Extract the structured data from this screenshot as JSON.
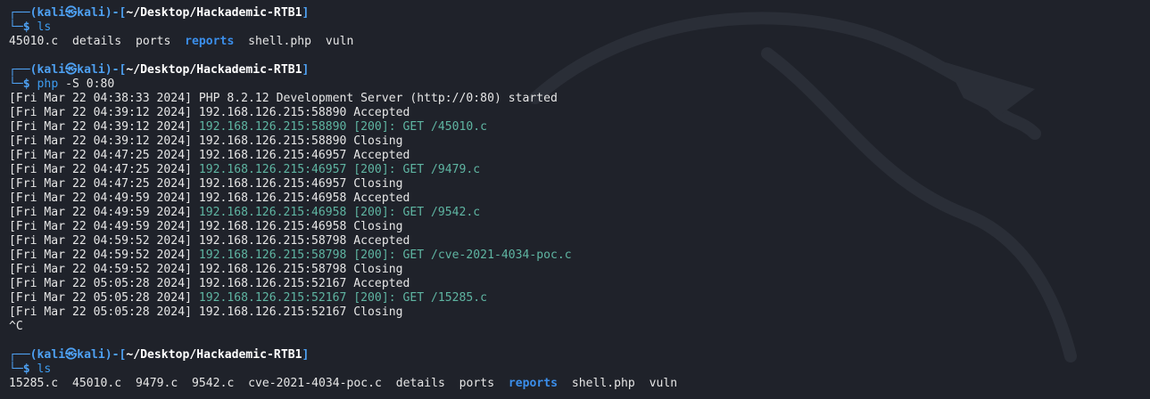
{
  "terminal": {
    "user": "kali",
    "host": "kali",
    "at_symbol": "㉿",
    "path": "~/Desktop/Hackademic-RTB1",
    "prompt_top_left": "┌──(",
    "prompt_top_mid": ")-[",
    "prompt_top_end": "]",
    "prompt_bottom": "└─$ ",
    "blocks": [
      {
        "command": "ls",
        "output_files": [
          "45010.c",
          "details",
          "ports",
          "reports",
          "shell.php",
          "vuln"
        ],
        "dir_entries": [
          "reports"
        ]
      },
      {
        "command_name": "php",
        "command_args": " -S 0:80",
        "log": [
          {
            "ts": "[Fri Mar 22 04:38:33 2024]",
            "msg": "PHP 8.2.12 Development Server (http://0:80) started",
            "highlight": false
          },
          {
            "ts": "[Fri Mar 22 04:39:12 2024]",
            "msg": "192.168.126.215:58890 Accepted",
            "highlight": false
          },
          {
            "ts": "[Fri Mar 22 04:39:12 2024]",
            "msg": "192.168.126.215:58890 [200]: GET /45010.c",
            "highlight": true
          },
          {
            "ts": "[Fri Mar 22 04:39:12 2024]",
            "msg": "192.168.126.215:58890 Closing",
            "highlight": false
          },
          {
            "ts": "[Fri Mar 22 04:47:25 2024]",
            "msg": "192.168.126.215:46957 Accepted",
            "highlight": false
          },
          {
            "ts": "[Fri Mar 22 04:47:25 2024]",
            "msg": "192.168.126.215:46957 [200]: GET /9479.c",
            "highlight": true
          },
          {
            "ts": "[Fri Mar 22 04:47:25 2024]",
            "msg": "192.168.126.215:46957 Closing",
            "highlight": false
          },
          {
            "ts": "[Fri Mar 22 04:49:59 2024]",
            "msg": "192.168.126.215:46958 Accepted",
            "highlight": false
          },
          {
            "ts": "[Fri Mar 22 04:49:59 2024]",
            "msg": "192.168.126.215:46958 [200]: GET /9542.c",
            "highlight": true
          },
          {
            "ts": "[Fri Mar 22 04:49:59 2024]",
            "msg": "192.168.126.215:46958 Closing",
            "highlight": false
          },
          {
            "ts": "[Fri Mar 22 04:59:52 2024]",
            "msg": "192.168.126.215:58798 Accepted",
            "highlight": false
          },
          {
            "ts": "[Fri Mar 22 04:59:52 2024]",
            "msg": "192.168.126.215:58798 [200]: GET /cve-2021-4034-poc.c",
            "highlight": true
          },
          {
            "ts": "[Fri Mar 22 04:59:52 2024]",
            "msg": "192.168.126.215:58798 Closing",
            "highlight": false
          },
          {
            "ts": "[Fri Mar 22 05:05:28 2024]",
            "msg": "192.168.126.215:52167 Accepted",
            "highlight": false
          },
          {
            "ts": "[Fri Mar 22 05:05:28 2024]",
            "msg": "192.168.126.215:52167 [200]: GET /15285.c",
            "highlight": true
          },
          {
            "ts": "[Fri Mar 22 05:05:28 2024]",
            "msg": "192.168.126.215:52167 Closing",
            "highlight": false
          }
        ],
        "interrupt": "^C"
      },
      {
        "command": "ls",
        "output_files": [
          "15285.c",
          "45010.c",
          "9479.c",
          "9542.c",
          "cve-2021-4034-poc.c",
          "details",
          "ports",
          "reports",
          "shell.php",
          "vuln"
        ],
        "dir_entries": [
          "reports"
        ]
      }
    ]
  },
  "colors": {
    "background": "#1f222a",
    "prompt_blue": "#4ea1f3",
    "directory_blue": "#3b8eea",
    "highlight_teal": "#5fb5a2",
    "text": "#e6e6e6"
  },
  "icons": {
    "watermark": "kali-dragon-icon"
  }
}
